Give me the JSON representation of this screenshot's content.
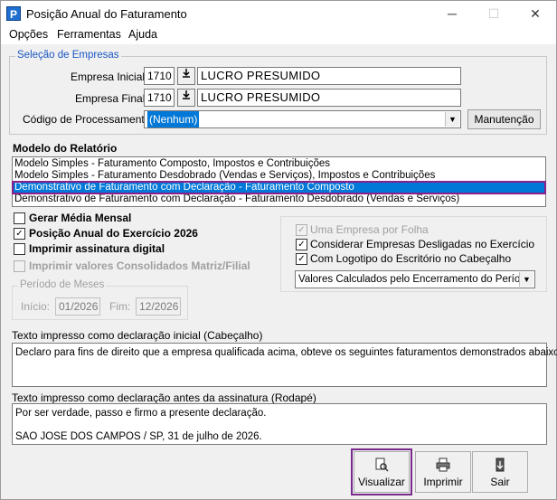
{
  "window": {
    "title": "Posição Anual do Faturamento",
    "app_icon": "P",
    "minimize": "─",
    "maximize": "☐",
    "close": "✕"
  },
  "menu": [
    {
      "label": "Opções"
    },
    {
      "label": "Ferramentas"
    },
    {
      "label": "Ajuda"
    }
  ],
  "selecao": {
    "legend": "Seleção de Empresas",
    "empresa_inicial": {
      "label": "Empresa Inicial",
      "code": "1710",
      "name": "LUCRO PRESUMIDO"
    },
    "empresa_final": {
      "label": "Empresa Final",
      "code": "1710",
      "name": "LUCRO PRESUMIDO"
    },
    "codigo": {
      "label": "Código de Processamento",
      "value": "(Nenhum)"
    },
    "manutencao_button": "Manutenção"
  },
  "modelo": {
    "label": "Modelo do Relatório",
    "items": [
      "Modelo Simples - Faturamento Composto, Impostos e Contribuições",
      "Modelo Simples - Faturamento Desdobrado (Vendas e Serviços), Impostos e Contribuições",
      "Demonstrativo de Faturamento com Declaração - Faturamento Composto",
      "Demonstrativo de Faturamento com Declaração - Faturamento Desdobrado (Vendas e Serviços)"
    ],
    "selected_index": 2
  },
  "options_left": [
    {
      "label": "Gerar Média Mensal",
      "checked": false,
      "disabled": false
    },
    {
      "label": "Posição Anual do Exercício 2026",
      "checked": true,
      "disabled": false
    },
    {
      "label": "Imprimir assinatura digital",
      "checked": false,
      "disabled": false
    },
    {
      "label": "Imprimir valores Consolidados Matriz/Filial",
      "checked": false,
      "disabled": true
    }
  ],
  "options_right": [
    {
      "label": "Uma Empresa por Folha",
      "checked": true,
      "disabled": true
    },
    {
      "label": "Considerar Empresas Desligadas no Exercício",
      "checked": true,
      "disabled": false
    },
    {
      "label": "Com Logotipo do Escritório no Cabeçalho",
      "checked": true,
      "disabled": false
    }
  ],
  "valores_combo": "Valores Calculados pelo Encerramento do Período",
  "periodo": {
    "legend": "Período de Meses",
    "inicio_label": "Início:",
    "inicio": "01/2026",
    "fim_label": "Fim:",
    "fim": "12/2026"
  },
  "texto_inicial": {
    "label": "Texto impresso como declaração inicial (Cabeçalho)",
    "value": "Declaro para fins de direito que a empresa qualificada acima, obteve os seguintes faturamentos demonstrados abaixo."
  },
  "texto_rodape": {
    "label": "Texto impresso como declaração antes da assinatura (Rodapé)",
    "value": "Por ser verdade, passo e firmo a presente declaração.\n\nSAO JOSE DOS CAMPOS / SP, 31 de julho de 2026."
  },
  "buttons": {
    "visualizar": "Visualizar",
    "imprimir": "Imprimir",
    "sair": "Sair"
  },
  "icons": {
    "download": "download-arrow-icon",
    "preview": "preview-magnifier-icon",
    "printer": "printer-icon",
    "exit": "exit-door-icon"
  },
  "colors": {
    "selection": "#0078d7",
    "focus_outline": "#8b1f8b",
    "legend_blue": "#1a56c4"
  }
}
